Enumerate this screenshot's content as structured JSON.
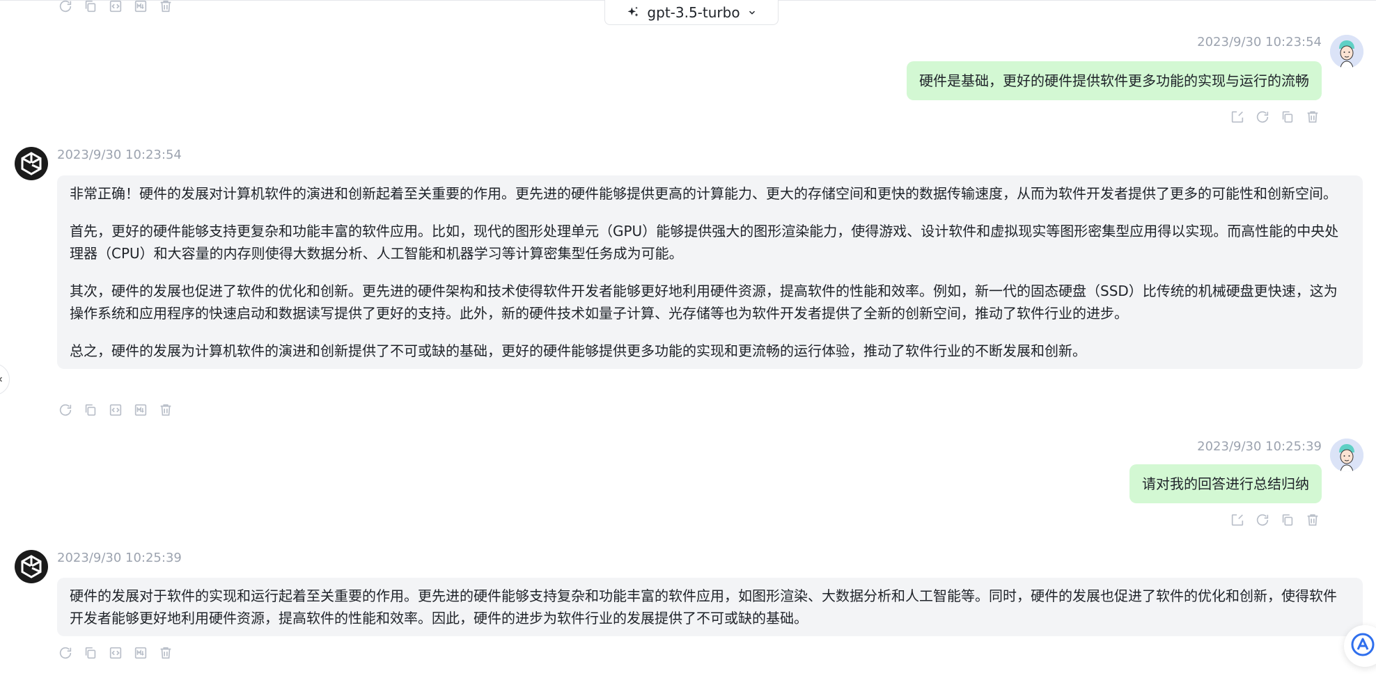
{
  "header": {
    "model_label": "gpt-3.5-turbo",
    "model_icon": "sparkle-icon",
    "dropdown_icon": "chevron-down-icon"
  },
  "messages": [
    {
      "role": "user",
      "timestamp": "2023/9/30 10:23:54",
      "text": "硬件是基础，更好的硬件提供软件更多功能的实现与运行的流畅"
    },
    {
      "role": "assistant",
      "timestamp": "2023/9/30 10:23:54",
      "paragraphs": [
        "非常正确！硬件的发展对计算机软件的演进和创新起着至关重要的作用。更先进的硬件能够提供更高的计算能力、更大的存储空间和更快的数据传输速度，从而为软件开发者提供了更多的可能性和创新空间。",
        "首先，更好的硬件能够支持更复杂和功能丰富的软件应用。比如，现代的图形处理单元（GPU）能够提供强大的图形渲染能力，使得游戏、设计软件和虚拟现实等图形密集型应用得以实现。而高性能的中央处理器（CPU）和大容量的内存则使得大数据分析、人工智能和机器学习等计算密集型任务成为可能。",
        "其次，硬件的发展也促进了软件的优化和创新。更先进的硬件架构和技术使得软件开发者能够更好地利用硬件资源，提高软件的性能和效率。例如，新一代的固态硬盘（SSD）比传统的机械硬盘更快速，这为操作系统和应用程序的快速启动和数据读写提供了更好的支持。此外，新的硬件技术如量子计算、光存储等也为软件开发者提供了全新的创新空间，推动了软件行业的进步。",
        "总之，硬件的发展为计算机软件的演进和创新提供了不可或缺的基础，更好的硬件能够提供更多功能的实现和更流畅的运行体验，推动了软件行业的不断发展和创新。"
      ]
    },
    {
      "role": "user",
      "timestamp": "2023/9/30 10:25:39",
      "text": "请对我的回答进行总结归纳"
    },
    {
      "role": "assistant",
      "timestamp": "2023/9/30 10:25:39",
      "paragraphs": [
        "硬件的发展对于软件的实现和运行起着至关重要的作用。更先进的硬件能够支持复杂和功能丰富的软件应用，如图形渲染、大数据分析和人工智能等。同时，硬件的发展也促进了软件的优化和创新，使得软件开发者能够更好地利用硬件资源，提高软件的性能和效率。因此，硬件的进步为软件行业的发展提供了不可或缺的基础。"
      ]
    }
  ],
  "actions": {
    "assistant": [
      "refresh-icon",
      "copy-icon",
      "code-icon",
      "markdown-icon",
      "delete-icon"
    ],
    "user": [
      "edit-icon",
      "refresh-icon",
      "copy-icon",
      "delete-icon"
    ]
  },
  "colors": {
    "user_bubble": "#d3f8d3",
    "assistant_bubble": "#f3f4f6",
    "timestamp": "#9ca3af",
    "icon": "#b8bec8",
    "accent": "#2f6fed"
  }
}
